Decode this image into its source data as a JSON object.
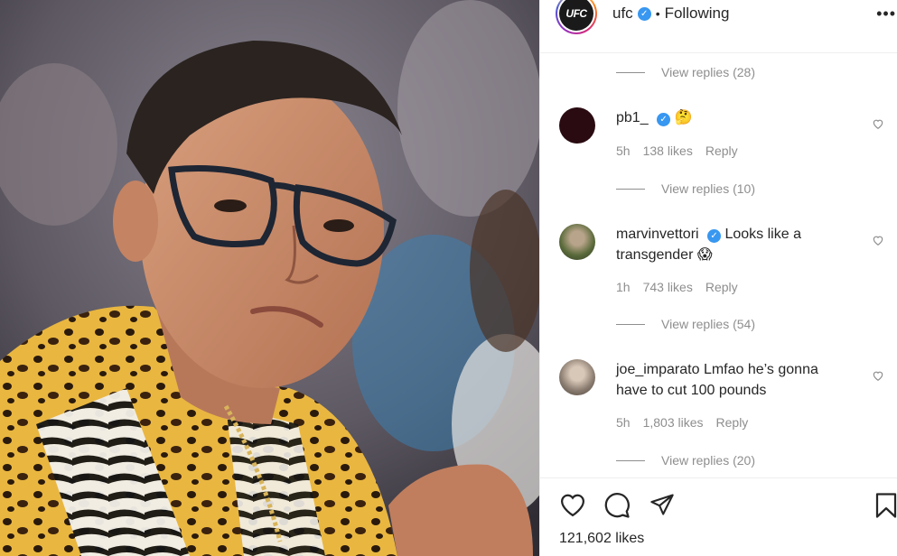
{
  "header": {
    "avatar_text": "UFC",
    "username": "ufc",
    "separator": "•",
    "follow_status": "Following",
    "more": "•••"
  },
  "thread": {
    "replies_top": "View replies (28)",
    "comments": [
      {
        "username": "pb1_",
        "text": "",
        "emoji": "🤔",
        "time": "5h",
        "likes": "138 likes",
        "reply": "Reply",
        "replies": "View replies (10)",
        "avatar_color": "#2a0b12"
      },
      {
        "username": "marvinvettori",
        "text": "Looks like a transgender",
        "emoji": "😱",
        "time": "1h",
        "likes": "743 likes",
        "reply": "Reply",
        "replies": "View replies (54)",
        "avatar_color": "#5a6a3a"
      },
      {
        "username": "joe_imparato",
        "text": "Lmfao he’s gonna have to cut 100 pounds",
        "emoji": "",
        "time": "5h",
        "likes": "1,803 likes",
        "reply": "Reply",
        "replies": "View replies (20)",
        "avatar_color": "#8a7c70"
      }
    ]
  },
  "actions": {
    "like_icon": "heart-outline-icon",
    "comment_icon": "comment-bubble-icon",
    "share_icon": "paper-plane-icon",
    "save_icon": "bookmark-icon",
    "likes_total": "121,602 likes"
  },
  "colors": {
    "text": "#262626",
    "muted": "#8e8e8e",
    "verified": "#3897f0",
    "border": "#efefef"
  }
}
